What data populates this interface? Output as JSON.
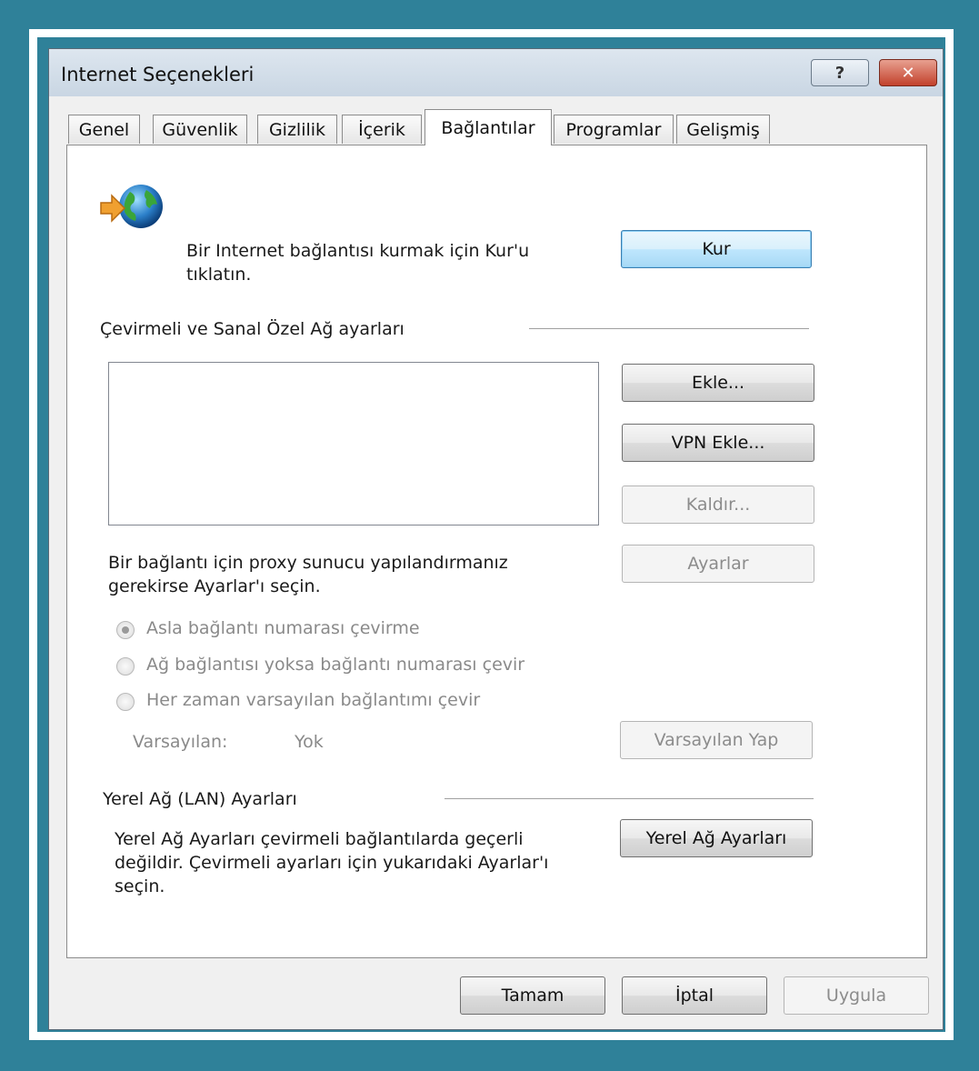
{
  "window": {
    "title": "Internet Seçenekleri",
    "help_glyph": "?",
    "close_glyph": "✕"
  },
  "tabs": [
    {
      "label": "Genel"
    },
    {
      "label": "Güvenlik"
    },
    {
      "label": "Gizlilik"
    },
    {
      "label": "İçerik"
    },
    {
      "label": "Bağlantılar",
      "selected": true
    },
    {
      "label": "Programlar"
    },
    {
      "label": "Gelişmiş"
    }
  ],
  "setup": {
    "icon": "globe-arrow-icon",
    "text_line1": "Bir Internet bağlantısı kurmak için Kur'u",
    "text_line2": "tıklatın.",
    "button": "Kur"
  },
  "dialup": {
    "heading": "Çevirmeli ve Sanal Özel Ağ ayarları",
    "add_button": "Ekle...",
    "add_vpn_button": "VPN Ekle...",
    "remove_button": "Kaldır...",
    "settings_button": "Ayarlar",
    "proxy_line1": "Bir bağlantı için proxy sunucu yapılandırmanız",
    "proxy_line2": "gerekirse Ayarlar'ı seçin.",
    "radios": [
      {
        "label": "Asla bağlantı numarası çevirme",
        "checked": true
      },
      {
        "label": "Ağ bağlantısı yoksa bağlantı numarası çevir",
        "checked": false
      },
      {
        "label": "Her zaman varsayılan bağlantımı çevir",
        "checked": false
      }
    ],
    "default_label": "Varsayılan:",
    "default_value": "Yok",
    "set_default_button": "Varsayılan Yap"
  },
  "lan": {
    "heading": "Yerel Ağ (LAN) Ayarları",
    "text_line1": "Yerel Ağ Ayarları çevirmeli bağlantılarda geçerli",
    "text_line2": "değildir. Çevirmeli ayarları için yukarıdaki Ayarlar'ı",
    "text_line3": "seçin.",
    "button": "Yerel Ağ Ayarları"
  },
  "footer": {
    "ok": "Tamam",
    "cancel": "İptal",
    "apply": "Uygula"
  },
  "colors": {
    "background": "#2f8199",
    "default_button": "#bee6fd",
    "close_button": "#c2412c"
  }
}
